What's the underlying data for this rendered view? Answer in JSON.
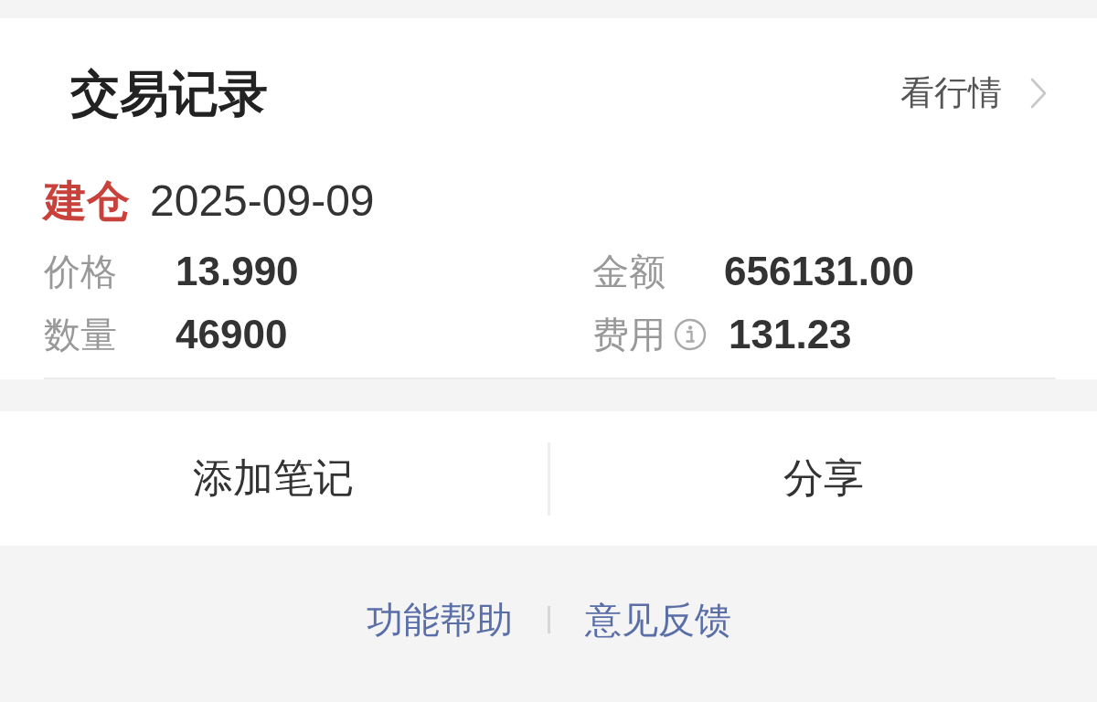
{
  "header": {
    "title": "交易记录",
    "link": "看行情"
  },
  "trade": {
    "kind": "open",
    "type": "建仓",
    "date": "2025-09-09",
    "fields": [
      {
        "label": "价格",
        "value": "13.990",
        "info": false
      },
      {
        "label": "金额",
        "value": "656131.00",
        "info": false
      },
      {
        "label": "数量",
        "value": "46900",
        "info": false
      },
      {
        "label": "费用",
        "value": "131.23",
        "info": true
      }
    ]
  },
  "actions": [
    "添加笔记",
    "分享"
  ],
  "footer_links": [
    "功能帮助",
    "意见反馈"
  ]
}
